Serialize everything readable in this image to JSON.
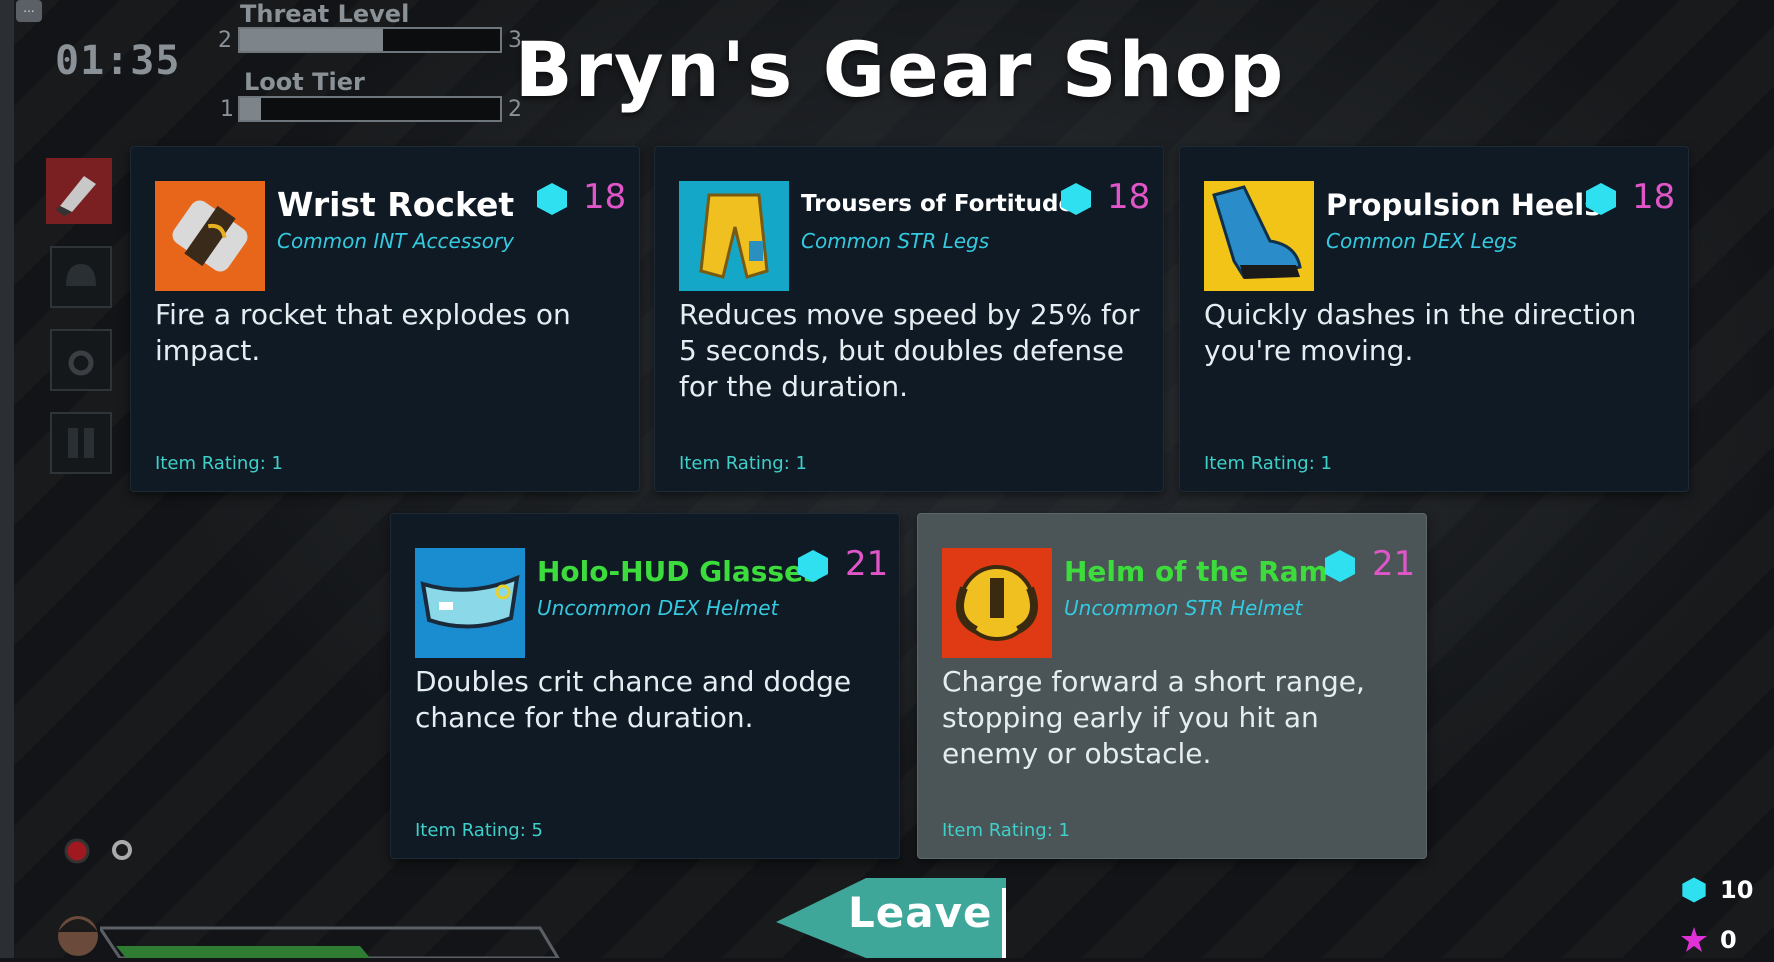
{
  "hud": {
    "menu_label": "...",
    "timer": "01:35",
    "threat": {
      "label": "Threat Level",
      "min": "2",
      "max": "3",
      "progress": 0.55
    },
    "loot": {
      "label": "Loot Tier",
      "min": "1",
      "max": "2",
      "progress": 0.08
    }
  },
  "shop": {
    "title": "Bryn's Gear Shop",
    "items": [
      {
        "name": "Wrist Rocket",
        "rarity": "Common INT Accessory",
        "price": "18",
        "description": "Fire a rocket that explodes on impact.",
        "rating": "Item Rating: 1",
        "icon": "wrist-rocket-icon"
      },
      {
        "name": "Trousers of Fortitude",
        "rarity": "Common STR Legs",
        "price": "18",
        "description": "Reduces move speed by 25% for 5 seconds, but doubles defense for the duration.",
        "rating": "Item Rating: 1",
        "icon": "trousers-icon"
      },
      {
        "name": "Propulsion Heels",
        "rarity": "Common DEX Legs",
        "price": "18",
        "description": "Quickly dashes in the direction you're moving.",
        "rating": "Item Rating: 1",
        "icon": "boot-icon"
      },
      {
        "name": "Holo-HUD Glasses",
        "rarity": "Uncommon DEX Helmet",
        "price": "21",
        "description": "Doubles crit chance and dodge chance for the duration.",
        "rating": "Item Rating: 5",
        "icon": "glasses-icon"
      },
      {
        "name": "Helm of the Ram",
        "rarity": "Uncommon STR Helmet",
        "price": "21",
        "description": "Charge forward a short range, stopping early if you hit an enemy or obstacle.",
        "rating": "Item Rating: 1",
        "icon": "ram-helm-icon"
      }
    ],
    "leave_label": "Leave"
  },
  "currency": {
    "gems": "10",
    "stars": "0"
  },
  "colors": {
    "gem": "#2ee0f0",
    "price": "#e056c8",
    "uncommon": "#3ddc3d",
    "rarity_text": "#35c9e0",
    "rating_text": "#3fd0c9"
  }
}
